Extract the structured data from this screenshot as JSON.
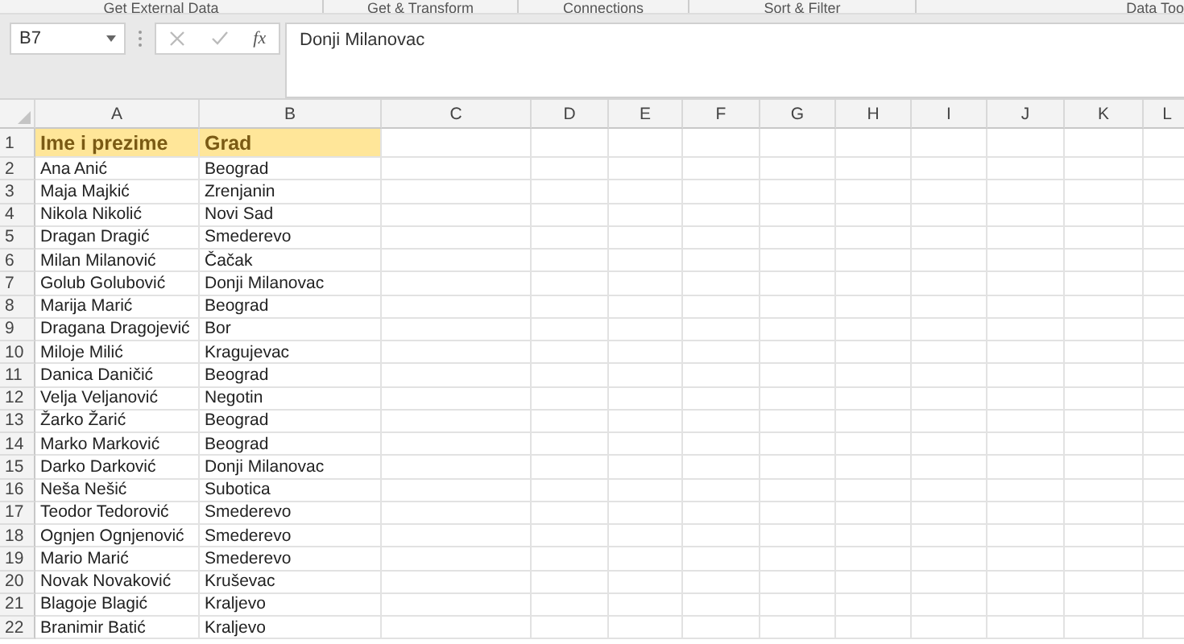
{
  "ribbon_groups": [
    "Get External Data",
    "Get & Transform",
    "Connections",
    "Sort & Filter",
    "Data Too"
  ],
  "formula_bar": {
    "name_box": "B7",
    "function_button": "fx",
    "value": "Donji Milanovac"
  },
  "columns": [
    "A",
    "B",
    "C",
    "D",
    "E",
    "F",
    "G",
    "H",
    "I",
    "J",
    "K",
    "L"
  ],
  "rows": [
    {
      "number": "1",
      "kind": "header",
      "cells": [
        "Ime i prezime",
        "Grad"
      ]
    },
    {
      "number": "2",
      "kind": "data",
      "cells": [
        "Ana Anić",
        "Beograd"
      ]
    },
    {
      "number": "3",
      "kind": "data",
      "cells": [
        "Maja Majkić",
        "Zrenjanin"
      ]
    },
    {
      "number": "4",
      "kind": "data",
      "cells": [
        "Nikola Nikolić",
        "Novi Sad"
      ]
    },
    {
      "number": "5",
      "kind": "data",
      "cells": [
        "Dragan Dragić",
        "Smederevo"
      ]
    },
    {
      "number": "6",
      "kind": "data",
      "cells": [
        "Milan Milanović",
        "Čačak"
      ]
    },
    {
      "number": "7",
      "kind": "data",
      "cells": [
        "Golub Golubović",
        "Donji Milanovac"
      ]
    },
    {
      "number": "8",
      "kind": "data",
      "cells": [
        "Marija Marić",
        "Beograd"
      ]
    },
    {
      "number": "9",
      "kind": "data",
      "cells": [
        "Dragana Dragojević",
        "Bor"
      ]
    },
    {
      "number": "10",
      "kind": "data",
      "cells": [
        "Miloje Milić",
        "Kragujevac"
      ]
    },
    {
      "number": "11",
      "kind": "data",
      "cells": [
        "Danica Daničić",
        "Beograd"
      ]
    },
    {
      "number": "12",
      "kind": "data",
      "cells": [
        "Velja Veljanović",
        "Negotin"
      ]
    },
    {
      "number": "13",
      "kind": "data",
      "cells": [
        "Žarko Žarić",
        "Beograd"
      ]
    },
    {
      "number": "14",
      "kind": "data",
      "cells": [
        "Marko Marković",
        "Beograd"
      ]
    },
    {
      "number": "15",
      "kind": "data",
      "cells": [
        "Darko Darković",
        "Donji Milanovac"
      ]
    },
    {
      "number": "16",
      "kind": "data",
      "cells": [
        "Neša Nešić",
        "Subotica"
      ]
    },
    {
      "number": "17",
      "kind": "data",
      "cells": [
        "Teodor Tedorović",
        "Smederevo"
      ]
    },
    {
      "number": "18",
      "kind": "data",
      "cells": [
        "Ognjen Ognjenović",
        "Smederevo"
      ]
    },
    {
      "number": "19",
      "kind": "data",
      "cells": [
        "Mario Marić",
        "Smederevo"
      ]
    },
    {
      "number": "20",
      "kind": "data",
      "cells": [
        "Novak Novaković",
        "Kruševac"
      ]
    },
    {
      "number": "21",
      "kind": "data",
      "cells": [
        "Blagoje Blagić",
        "Kraljevo"
      ]
    },
    {
      "number": "22",
      "kind": "data",
      "cells": [
        "Branimir Batić",
        "Kraljevo"
      ]
    }
  ]
}
